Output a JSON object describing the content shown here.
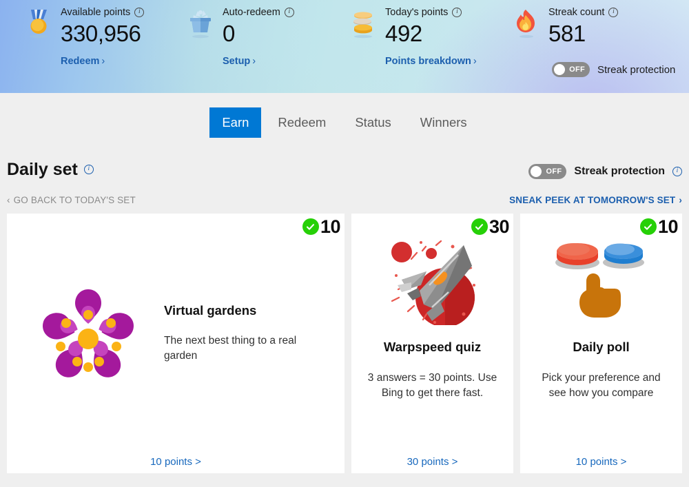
{
  "banner": {
    "stats": [
      {
        "icon": "medal-icon",
        "label": "Available points",
        "value": "330,956",
        "link": "Redeem",
        "chevron": "›"
      },
      {
        "icon": "gift-box-icon",
        "label": "Auto-redeem",
        "value": "0",
        "link": "Setup",
        "chevron": "›"
      },
      {
        "icon": "coins-icon",
        "label": "Today's points",
        "value": "492",
        "link": "Points breakdown",
        "chevron": "›"
      },
      {
        "icon": "flame-icon",
        "label": "Streak count",
        "value": "581",
        "link": "",
        "chevron": ""
      }
    ],
    "streak_protection": {
      "state": "OFF",
      "label": "Streak protection"
    }
  },
  "tabs": [
    {
      "label": "Earn",
      "active": true
    },
    {
      "label": "Redeem",
      "active": false
    },
    {
      "label": "Status",
      "active": false
    },
    {
      "label": "Winners",
      "active": false
    }
  ],
  "daily_set": {
    "title": "Daily set",
    "go_back_label": "GO BACK TO TODAY'S SET",
    "go_back_chevron": "‹",
    "sneak_peek_label": "SNEAK PEEK AT TOMORROW'S SET",
    "sneak_peek_chevron": "›",
    "streak_protection": {
      "state": "OFF",
      "label": "Streak protection"
    },
    "cards": [
      {
        "art": "cherry-blossom-icon",
        "points_badge": "10",
        "completed": true,
        "title": "Virtual gardens",
        "description": "The next best thing to a real garden",
        "footer": "10 points  >"
      },
      {
        "art": "spaceship-icon",
        "points_badge": "30",
        "completed": true,
        "title": "Warpspeed quiz",
        "description": "3 answers = 30 points. Use Bing to get there fast.",
        "footer": "30 points  >"
      },
      {
        "art": "poll-buttons-icon",
        "points_badge": "10",
        "completed": true,
        "title": "Daily poll",
        "description": "Pick your preference and see how you compare",
        "footer": "10 points  >"
      }
    ]
  },
  "colors": {
    "accent_blue": "#0078d4",
    "link_blue": "#1c5fae",
    "success_green": "#26d007",
    "page_bg": "#efefef"
  }
}
